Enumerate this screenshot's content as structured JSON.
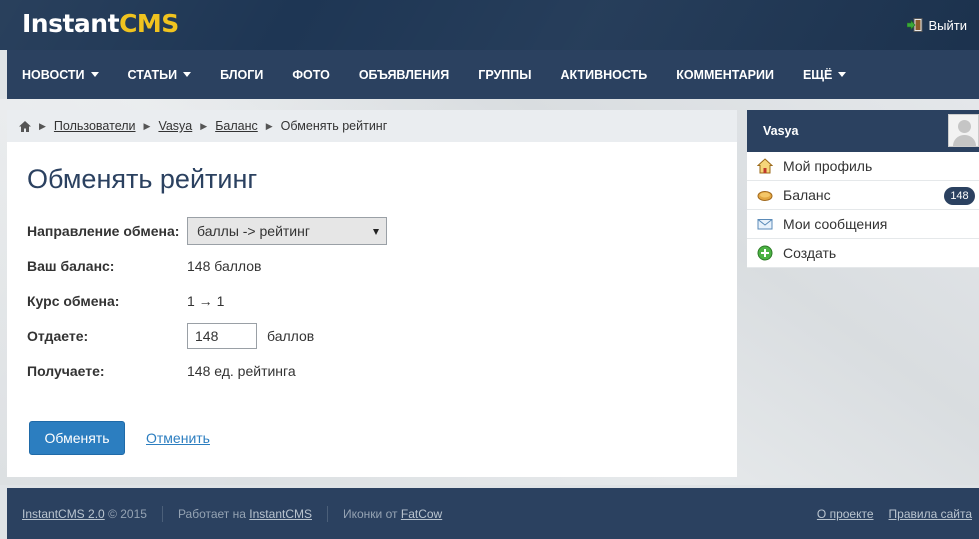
{
  "header": {
    "logo_part1": "Instant",
    "logo_part2": "CMS",
    "logout_label": "Выйти",
    "logout_icon": "logout-icon"
  },
  "nav": {
    "items": [
      {
        "label": "НОВОСТИ",
        "dropdown": true
      },
      {
        "label": "СТАТЬИ",
        "dropdown": true
      },
      {
        "label": "БЛОГИ",
        "dropdown": false
      },
      {
        "label": "ФОТО",
        "dropdown": false
      },
      {
        "label": "ОБЪЯВЛЕНИЯ",
        "dropdown": false
      },
      {
        "label": "ГРУППЫ",
        "dropdown": false
      },
      {
        "label": "АКТИВНОСТЬ",
        "dropdown": false
      },
      {
        "label": "КОММЕНТАРИИ",
        "dropdown": false
      },
      {
        "label": "ЕЩЁ",
        "dropdown": true
      }
    ]
  },
  "breadcrumb": {
    "home_icon": "home-icon",
    "items": [
      "Пользователи",
      "Vasya",
      "Баланс"
    ],
    "current": "Обменять рейтинг",
    "separator": "▶"
  },
  "form": {
    "title": "Обменять рейтинг",
    "direction_label": "Направление обмена:",
    "direction_value": "баллы -> рейтинг",
    "balance_label": "Ваш баланс:",
    "balance_value": "148 баллов",
    "rate_label": "Курс обмена:",
    "rate_value": "1 → 1",
    "give_label": "Отдаете:",
    "give_value": "148",
    "give_unit": "баллов",
    "receive_label": "Получаете:",
    "receive_value": "148 ед. рейтинга",
    "submit_label": "Обменять",
    "cancel_label": "Отменить"
  },
  "sidebar": {
    "username": "Vasya",
    "items": [
      {
        "label": "Мой профиль",
        "icon": "home-icon"
      },
      {
        "label": "Баланс",
        "icon": "coin-icon",
        "badge": "148"
      },
      {
        "label": "Мои сообщения",
        "icon": "envelope-icon"
      },
      {
        "label": "Создать",
        "icon": "plus-circle-icon"
      }
    ]
  },
  "footer": {
    "brand_link": "InstantCMS 2.0",
    "copyright": "© 2015",
    "powered_prefix": "Работает на",
    "powered_link": "InstantCMS",
    "icons_prefix": "Иконки от",
    "icons_link": "FatCow",
    "about_link": "О проекте",
    "rules_link": "Правила сайта"
  },
  "colors": {
    "header_bg": "#1e3654",
    "nav_bg": "#2b4160",
    "logo_accent": "#f0c31f",
    "button_bg": "#2c7ec0",
    "title_color": "#2b4160"
  }
}
